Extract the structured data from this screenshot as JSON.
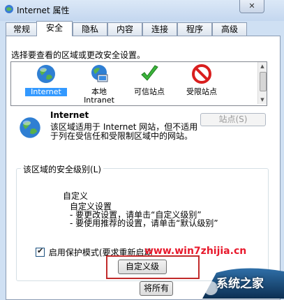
{
  "window": {
    "title": "Internet 属性",
    "close_label": "✕"
  },
  "tabs": [
    {
      "label": "常规"
    },
    {
      "label": "安全"
    },
    {
      "label": "隐私"
    },
    {
      "label": "内容"
    },
    {
      "label": "连接"
    },
    {
      "label": "程序"
    },
    {
      "label": "高级"
    }
  ],
  "zones": {
    "instruction": "选择要查看的区域或更改安全设置。",
    "items": [
      {
        "label": "Internet",
        "icon": "globe-icon"
      },
      {
        "label": "本地\nIntranet",
        "icon": "intranet-icon"
      },
      {
        "label": "可信站点",
        "icon": "checkmark-icon"
      },
      {
        "label": "受限站点",
        "icon": "restricted-icon"
      }
    ]
  },
  "zone_info": {
    "title": "Internet",
    "description": "该区域适用于 Internet 网站，但不适用于列在受信任和受限制区域中的网站。",
    "sites_button": "站点(S)"
  },
  "security_level": {
    "group_title": "该区域的安全级别(L)",
    "level_name": "自定义",
    "lines": [
      "自定义设置",
      "- 要更改设置，请单击“自定义级别”",
      "- 要使用推荐的设置，请单击“默认级别”"
    ],
    "protected_mode_label": "启用保护模式(要求重新启动",
    "protected_mode_checked": true,
    "custom_level_button": "自定义级",
    "reset_button": "将所有"
  },
  "watermark": {
    "url": "www.win7zhijia.cn",
    "brand": "系统之家"
  },
  "colors": {
    "selection": "#3399ff",
    "watermark_red": "#e8192c"
  }
}
